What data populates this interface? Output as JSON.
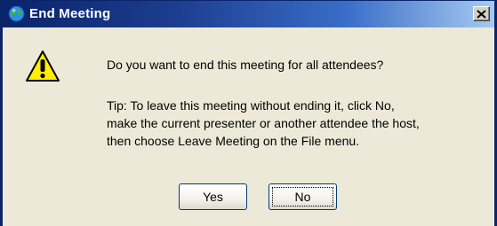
{
  "window": {
    "title": "End Meeting",
    "app_icon": "globe-icon",
    "close_icon": "close-icon"
  },
  "dialog": {
    "icon": "warning-icon",
    "message": "Do you want to end this meeting for all attendees?",
    "tip_lines": [
      "Tip: To leave this meeting without ending it, click No,",
      "make the current presenter or another attendee the host,",
      "then choose Leave Meeting on the File menu."
    ]
  },
  "buttons": {
    "yes_label": "Yes",
    "no_label": "No",
    "default": "No"
  },
  "colors": {
    "titlebar": "#0a246a",
    "dialog_background": "#ece9d8",
    "warning_fill": "#ffee00"
  }
}
